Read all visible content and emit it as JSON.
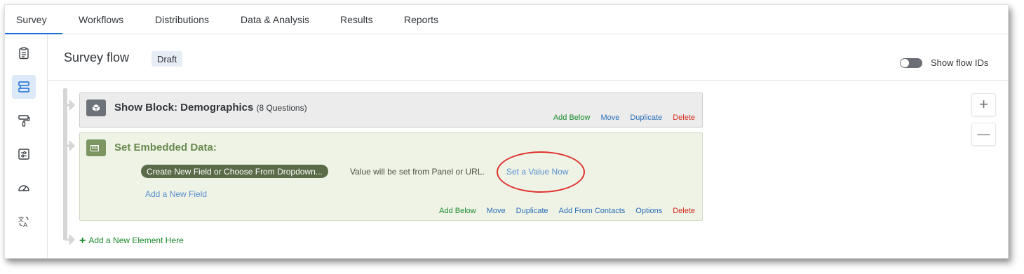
{
  "tabs": [
    "Survey",
    "Workflows",
    "Distributions",
    "Data & Analysis",
    "Results",
    "Reports"
  ],
  "rail_icons": [
    "survey-clipboard-icon",
    "survey-flow-icon",
    "look-and-feel-icon",
    "survey-options-icon",
    "survey-checker-icon",
    "translate-icon"
  ],
  "header": {
    "title": "Survey flow",
    "status": "Draft",
    "toggle_label": "Show flow IDs",
    "toggle_on": false
  },
  "show_block": {
    "title": "Show Block: Demographics",
    "subtitle": "(8 Questions)",
    "actions": [
      "Add Below",
      "Move",
      "Duplicate",
      "Delete"
    ]
  },
  "embedded_block": {
    "title": "Set Embedded Data:",
    "icon_text": "ED",
    "field_placeholder": "Create New Field or Choose From Dropdown...",
    "value_text": "Value will be set from Panel or URL.",
    "set_value_link": "Set a Value Now",
    "add_field_link": "Add a New Field",
    "actions": [
      "Add Below",
      "Move",
      "Duplicate",
      "Add From Contacts",
      "Options",
      "Delete"
    ]
  },
  "add_element": "Add a New Element Here",
  "zoom": {
    "in": "+",
    "out": "—"
  },
  "colors": {
    "accent": "#1a6dd4",
    "add_green": "#1b8a2c",
    "link_blue": "#2c6fb8",
    "delete_red": "#d42b1e",
    "embedded_title_green": "#6a8a4e",
    "annotation_circle": "#e0322d"
  }
}
